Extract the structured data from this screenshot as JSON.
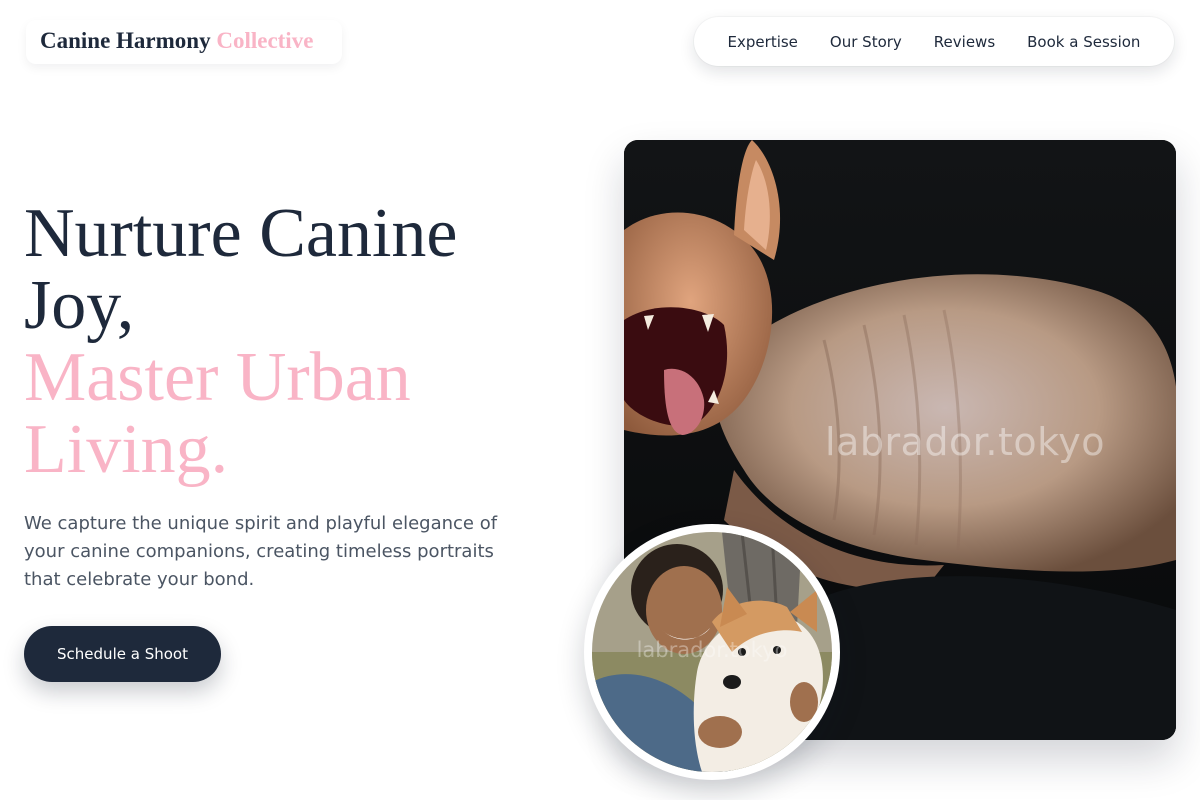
{
  "brand": {
    "name": "Canine Harmony",
    "accent": "Collective"
  },
  "nav": {
    "items": [
      {
        "label": "Expertise"
      },
      {
        "label": "Our Story"
      },
      {
        "label": "Reviews"
      },
      {
        "label": "Book a Session"
      }
    ]
  },
  "hero": {
    "headline_line1": "Nurture Canine",
    "headline_line2": "Joy,",
    "headline_accent_line1": "Master Urban",
    "headline_accent_line2": "Living.",
    "description": "We capture the unique spirit and playful elegance of your canine companions, creating timeless portraits that celebrate your bond.",
    "cta_label": "Schedule a Shoot"
  },
  "photos": {
    "main_watermark": "labrador.tokyo",
    "avatar_watermark": "labrador.tokyo"
  },
  "colors": {
    "dark": "#1e293b",
    "accent_pink": "#f9b4c6",
    "body_text": "#4b5563"
  }
}
